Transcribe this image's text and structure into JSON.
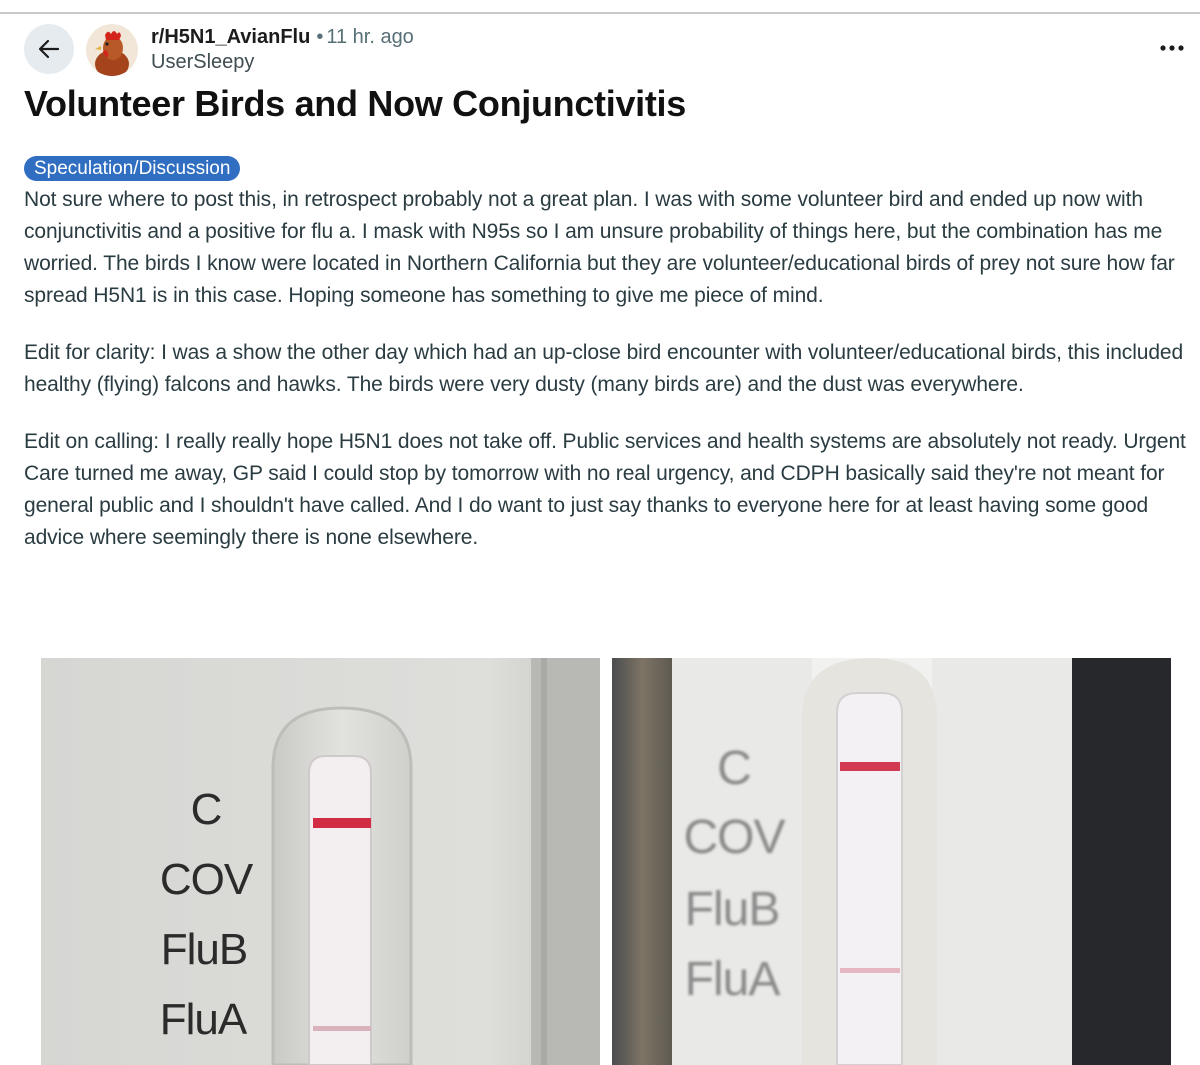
{
  "post": {
    "subreddit": "r/H5N1_AvianFlu",
    "separator": "•",
    "age": "11 hr. ago",
    "author": "UserSleepy",
    "title": "Volunteer Birds and Now Conjunctivitis",
    "flair": "Speculation/Discussion",
    "flair_color": "#2f6ec0",
    "paragraphs": [
      "Not sure where to post this, in retrospect probably not a great plan. I was with some volunteer bird and ended up now with conjunctivitis and a positive for flu a. I mask with N95s so I am unsure probability of things here, but the combination has me worried. The birds I know were located in Northern California but they are volunteer/educational birds of prey not sure how far spread H5N1 is in this case. Hoping someone has something to give me piece of mind.",
      "Edit for clarity: I was a show the other day which had an up-close bird encounter with volunteer/educational birds, this included healthy (flying) falcons and hawks. The birds were very dusty (many birds are) and the dust was everywhere.",
      "Edit on calling: I really really hope H5N1 does not take off. Public services and health systems are absolutely not ready. Urgent Care turned me away, GP said I could stop by tomorrow with no real urgency, and CDPH basically said they're not meant for general public and I shouldn't have called. And I do want to just say thanks to everyone here for at least having some good advice where seemingly there is none elsewhere."
    ]
  },
  "icons": {
    "back": "arrow-left-icon",
    "more": "more-horizontal-icon",
    "avatar": "rooster-avatar"
  },
  "test_images": [
    {
      "labels": [
        "C",
        "COV",
        "FluB",
        "FluA"
      ]
    },
    {
      "labels": [
        "C",
        "COV",
        "FluB",
        "FluA"
      ]
    }
  ]
}
